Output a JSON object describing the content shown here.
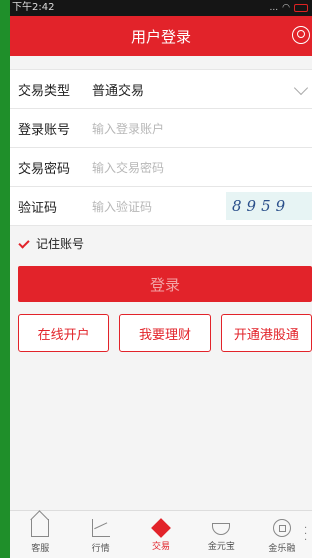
{
  "status": {
    "time": "下午2:42",
    "signal": "..."
  },
  "header": {
    "title": "用户登录"
  },
  "form": {
    "trade_type": {
      "label": "交易类型",
      "value": "普通交易"
    },
    "account": {
      "label": "登录账号",
      "placeholder": "输入登录账户"
    },
    "password": {
      "label": "交易密码",
      "placeholder": "输入交易密码"
    },
    "captcha": {
      "label": "验证码",
      "placeholder": "输入验证码",
      "image_text": "8959"
    }
  },
  "remember": {
    "label": "记住账号",
    "checked": true
  },
  "login_button": "登录",
  "actions": [
    "在线开户",
    "我要理财",
    "开通港股通"
  ],
  "tabs": [
    {
      "label": "客服",
      "icon": "home-icon"
    },
    {
      "label": "行情",
      "icon": "chart-icon"
    },
    {
      "label": "交易",
      "icon": "trade-icon",
      "active": true
    },
    {
      "label": "金元宝",
      "icon": "ingot-icon"
    },
    {
      "label": "金乐融",
      "icon": "coin-icon"
    }
  ],
  "colors": {
    "brand": "#e2232a",
    "frame": "#1f8f2a"
  }
}
